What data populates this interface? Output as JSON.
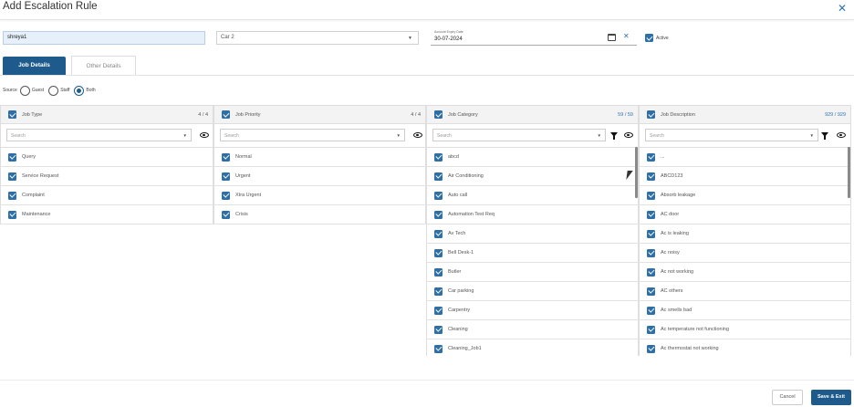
{
  "header": {
    "title": "Add Escalation Rule",
    "close": "✕"
  },
  "form": {
    "name_value": "shreya1",
    "select_value": "Car 2",
    "expiry_label": "Account Expiry Date",
    "expiry_value": "30-07-2024",
    "active_label": "Active"
  },
  "tabs": [
    {
      "label": "Job Details",
      "active": true
    },
    {
      "label": "Other Details",
      "active": false
    }
  ],
  "source": {
    "label": "Source",
    "options": [
      {
        "label": "Guest",
        "selected": false
      },
      {
        "label": "Staff",
        "selected": false
      },
      {
        "label": "Both",
        "selected": true
      }
    ]
  },
  "panels": [
    {
      "title": "Job Type",
      "count": "4 / 4",
      "search_placeholder": "Search",
      "items": [
        "Query",
        "Service Request",
        "Complaint",
        "Maintenance"
      ]
    },
    {
      "title": "Job Priority",
      "count": "4 / 4",
      "search_placeholder": "Search",
      "items": [
        "Normal",
        "Urgent",
        "Xtra Urgent",
        "Crisis"
      ]
    },
    {
      "title": "Job Category",
      "count": "59 / 59",
      "search_placeholder": "Search",
      "items": [
        "abcd",
        "Air Conditioning",
        "Auto call",
        "Automation Test Req",
        "Av Tech",
        "Bell Desk-1",
        "Butler",
        "Car parking",
        "Carpentry",
        "Cleaning",
        "Cleaning_Job1"
      ]
    },
    {
      "title": "Job Description",
      "count": "929 / 929",
      "search_placeholder": "Search",
      "items": [
        "...",
        "ABCD123",
        "Absorb leakage",
        "AC door",
        "Ac is leaking",
        "Ac noisy",
        "Ac not working",
        "AC others",
        "Ac smells bad",
        "Ac temperature not functioning",
        "Ac thermostat not working"
      ]
    }
  ],
  "footer": {
    "cancel": "Cancel",
    "save": "Save & Exit"
  },
  "colors": {
    "primary": "#1e5b8c",
    "link": "#2c74b3",
    "checkbox": "#2e6fa7"
  }
}
